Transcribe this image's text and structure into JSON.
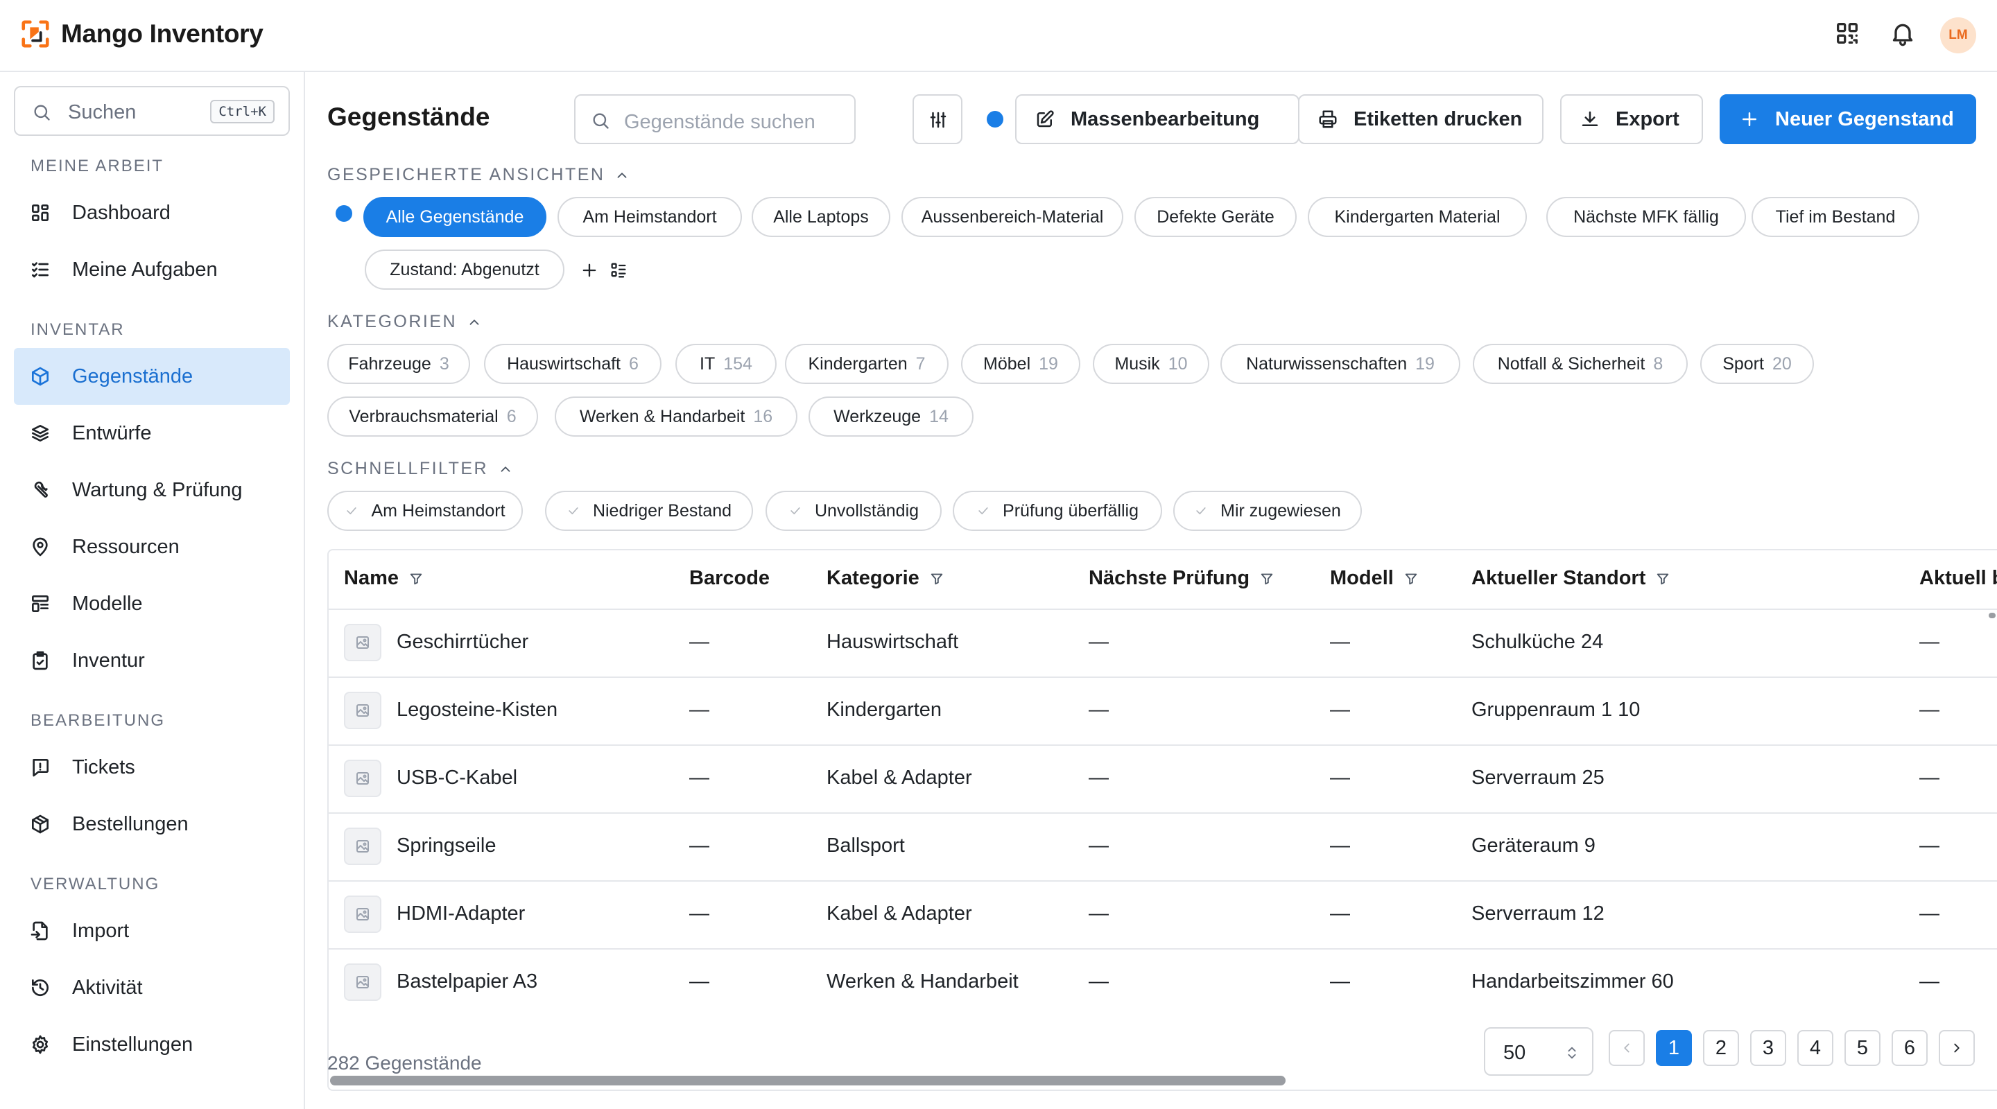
{
  "app": {
    "title": "Mango Inventory",
    "avatar_initials": "LM",
    "accent": "#1a7ee6",
    "logo_color": "#f97316"
  },
  "header_icons": [
    "qr-code-icon",
    "bell-icon"
  ],
  "sidebar": {
    "search_placeholder": "Suchen",
    "search_shortcut": "Ctrl+K",
    "sections": [
      {
        "label": "MEINE ARBEIT",
        "items": [
          {
            "label": "Dashboard",
            "icon": "dashboard-icon"
          },
          {
            "label": "Meine Aufgaben",
            "icon": "task-list-icon"
          }
        ]
      },
      {
        "label": "INVENTAR",
        "items": [
          {
            "label": "Gegenstände",
            "icon": "box-icon",
            "active": true
          },
          {
            "label": "Entwürfe",
            "icon": "layers-icon"
          },
          {
            "label": "Wartung & Prüfung",
            "icon": "wrench-icon"
          },
          {
            "label": "Ressourcen",
            "icon": "map-pin-icon"
          },
          {
            "label": "Modelle",
            "icon": "model-icon"
          },
          {
            "label": "Inventur",
            "icon": "clipboard-check-icon"
          }
        ]
      },
      {
        "label": "BEARBEITUNG",
        "items": [
          {
            "label": "Tickets",
            "icon": "ticket-icon"
          },
          {
            "label": "Bestellungen",
            "icon": "package-icon"
          }
        ]
      },
      {
        "label": "VERWALTUNG",
        "items": [
          {
            "label": "Import",
            "icon": "import-icon"
          },
          {
            "label": "Aktivität",
            "icon": "history-icon"
          },
          {
            "label": "Einstellungen",
            "icon": "gear-icon"
          }
        ]
      }
    ]
  },
  "main": {
    "title": "Gegenstände",
    "search_placeholder": "Gegenstände suchen",
    "buttons": {
      "bulk_edit": "Massenbearbeitung",
      "print_labels": "Etiketten drucken",
      "export": "Export",
      "new_item": "Neuer Gegenstand"
    },
    "saved_views_label": "GESPEICHERTE ANSICHTEN",
    "saved_views": [
      "Alle Gegenstände",
      "Am Heimstandort",
      "Alle Laptops",
      "Aussenbereich-Material",
      "Defekte Geräte",
      "Kindergarten Material",
      "Nächste MFK fällig",
      "Tief im Bestand",
      "Zustand: Abgenutzt"
    ],
    "categories_label": "KATEGORIEN",
    "categories": [
      {
        "name": "Fahrzeuge",
        "count": "3"
      },
      {
        "name": "Hauswirtschaft",
        "count": "6"
      },
      {
        "name": "IT",
        "count": "154"
      },
      {
        "name": "Kindergarten",
        "count": "7"
      },
      {
        "name": "Möbel",
        "count": "19"
      },
      {
        "name": "Musik",
        "count": "10"
      },
      {
        "name": "Naturwissenschaften",
        "count": "19"
      },
      {
        "name": "Notfall & Sicherheit",
        "count": "8"
      },
      {
        "name": "Sport",
        "count": "20"
      },
      {
        "name": "Verbrauchsmaterial",
        "count": "6"
      },
      {
        "name": "Werken & Handarbeit",
        "count": "16"
      },
      {
        "name": "Werkzeuge",
        "count": "14"
      }
    ],
    "quick_filters_label": "SCHNELLFILTER",
    "quick_filters": [
      "Am Heimstandort",
      "Niedriger Bestand",
      "Unvollständig",
      "Prüfung überfällig",
      "Mir zugewiesen"
    ],
    "table": {
      "columns": [
        "Name",
        "Barcode",
        "Kategorie",
        "Nächste Prüfung",
        "Modell",
        "Aktueller Standort",
        "Aktuell b"
      ],
      "rows": [
        {
          "name": "Geschirrtücher",
          "barcode": "—",
          "category": "Hauswirtschaft",
          "next_check": "—",
          "model": "—",
          "location": "Schulküche 24",
          "current": "—"
        },
        {
          "name": "Legosteine-Kisten",
          "barcode": "—",
          "category": "Kindergarten",
          "next_check": "—",
          "model": "—",
          "location": "Gruppenraum 1 10",
          "current": "—"
        },
        {
          "name": "USB-C-Kabel",
          "barcode": "—",
          "category": "Kabel & Adapter",
          "next_check": "—",
          "model": "—",
          "location": "Serverraum 25",
          "current": "—"
        },
        {
          "name": "Springseile",
          "barcode": "—",
          "category": "Ballsport",
          "next_check": "—",
          "model": "—",
          "location": "Geräteraum 9",
          "current": "—"
        },
        {
          "name": "HDMI-Adapter",
          "barcode": "—",
          "category": "Kabel & Adapter",
          "next_check": "—",
          "model": "—",
          "location": "Serverraum 12",
          "current": "—"
        },
        {
          "name": "Bastelpapier A3",
          "barcode": "—",
          "category": "Werken & Handarbeit",
          "next_check": "—",
          "model": "—",
          "location": "Handarbeitszimmer 60",
          "current": "—"
        }
      ]
    },
    "footer": {
      "total": "282 Gegenstände",
      "page_size": "50",
      "pages": [
        "1",
        "2",
        "3",
        "4",
        "5",
        "6"
      ],
      "current_page": "1"
    }
  }
}
